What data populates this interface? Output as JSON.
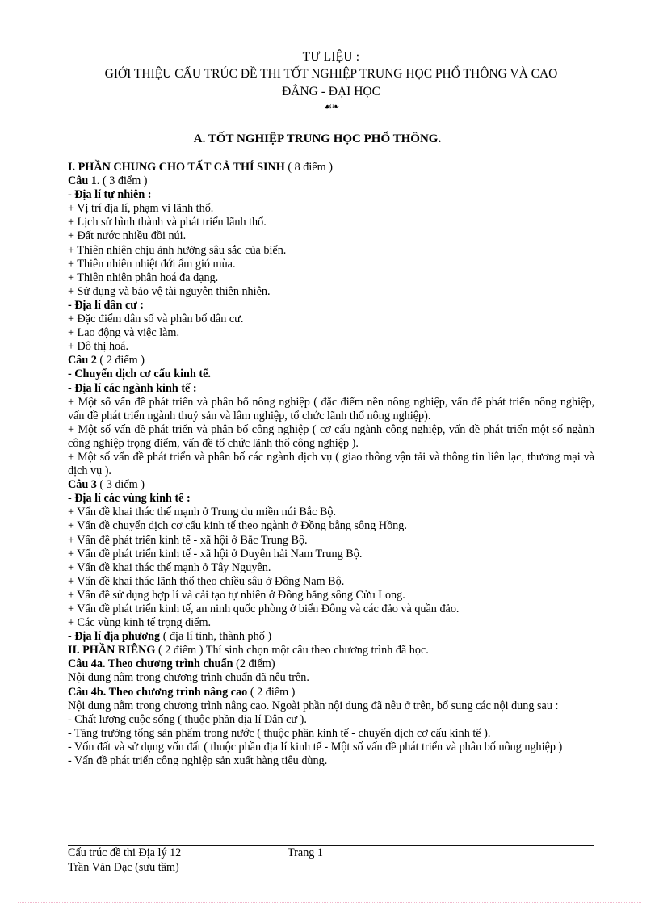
{
  "document": {
    "title_lines": [
      "TƯ LIỆU :",
      "GIỚI THIỆU CẤU TRÚC ĐỀ THI TỐT NGHIỆP TRUNG HỌC PHỔ THÔNG VÀ CAO",
      "ĐẲNG - ĐẠI HỌC"
    ],
    "ornament": "☙❧",
    "section_a_heading": "A. TỐT NGHIỆP TRUNG HỌC PHỔ THÔNG."
  },
  "part_one": {
    "heading_bold": "I. PHẦN CHUNG CHO TẤT CẢ THÍ SINH",
    "heading_normal": "( 8 điểm )",
    "cau1": {
      "label_bold": "Câu 1.",
      "label_normal": "( 3 điểm )",
      "sub1_bold": "- Địa lí tự nhiên :",
      "items1": [
        "+ Vị trí địa lí, phạm vi lãnh thổ.",
        "+ Lịch sử hình thành và phát triển lãnh thổ.",
        "+ Đất nước nhiều  đồi núi.",
        "+ Thiên nhiên  chịu  ảnh hưởng sâu sắc của biển.",
        "+ Thiên nhiên  nhiệt đới ẩm gió mùa.",
        "+ Thiên nhiên  phân hoá đa dạng.",
        "+ Sử dụng và bảo vệ tài nguyên  thiên nhiên."
      ],
      "sub2_bold": "- Địa lí dân cư :",
      "items2": [
        "+ Đặc điểm dân số và phân bố dân cư.",
        "+ Lao động và việc làm.",
        "+ Đô thị hoá."
      ]
    },
    "cau2": {
      "label_bold": "Câu 2",
      "label_normal": "( 2 điểm )",
      "sub1_bold": "- Chuyển dịch cơ cấu kinh tế.",
      "sub2_bold": "- Địa lí các ngành kinh tế :",
      "paragraphs": [
        "+ Một số vấn đề phát triển và phân bố nông nghiệp  ( đặc điểm nền nông nghiệp,  vấn đề phát triển nông nghiệp,  vấn đề phát triển ngành  thuỷ sản và lâm nghiệp, tổ chức lãnh thổ nông nghiệp).",
        "+ Một số vấn đề phát triển và phân bố công nghiệp  ( cơ cấu ngành  công nghiệp,  vấn đề phát triển một số ngành  công nghiệp  trọng điểm, vấn đề tổ chức lãnh thổ công nghiệp  ).",
        "+ Một số vấn đề phát triển và phân bố các ngành  dịch vụ ( giao thông vận tải và thông tin liên lạc, thương mại và dịch vụ )."
      ]
    },
    "cau3": {
      "label_bold": "Câu 3",
      "label_normal": "( 3 điểm )",
      "sub1_bold": "- Địa lí các vùng kinh tế :",
      "items": [
        "+ Vấn đề khai thác thế mạnh  ở Trung  du miền  núi Bắc Bộ.",
        "+ Vấn đề chuyển  dịch cơ cấu kinh tế theo ngành  ở Đồng bằng sông Hồng.",
        "+ Vấn đề phát triển  kinh tế - xã hội ở Bắc Trung  Bộ.",
        "+ Vấn đề phát triển  kinh tế - xã hội ở Duyên  hải Nam Trung  Bộ.",
        "+ Vấn đề khai thác thế mạnh  ở Tây Nguyên.",
        "+ Vấn đề khai thác lãnh thổ theo chiều  sâu ở Đông  Nam Bộ.",
        "+ Vấn đề sử dụng hợp lí  và cải tạo tự nhiên  ở Đồng bằng sông Cửu Long.",
        "+ Vấn đề phát triển  kinh tế, an ninh  quốc phòng ở biển Đông và các đảo và quần đảo.",
        "+ Các vùng  kinh tế trọng điểm."
      ],
      "sub2_bold": "- Địa lí địa phương",
      "sub2_normal": "( địa lí tỉnh,  thành phố )"
    }
  },
  "part_two": {
    "heading_bold": "II. PHẦN RIÊNG",
    "heading_normal": "( 2 điểm ) Thí sinh  chọn một câu theo chương trình  đã học.",
    "cau4a": {
      "label_bold": "Câu 4a.  Theo chương trình chuẩn",
      "label_normal": "(2 điểm)",
      "text": "Nội dung nằm trong chương trình  chuẩn đã nêu trên."
    },
    "cau4b": {
      "label_bold": "Câu 4b. Theo chương trình nâng cao",
      "label_normal": "( 2 điểm )",
      "intro": "Nội dung nằm trong chương trình  nâng cao. Ngoài phần nội dung  đã nêu ở trên, bổ sung  các nội dung sau :",
      "items": [
        "- Chất lượng cuộc sống  ( thuộc  phần địa lí Dân cư ).",
        "- Tăng trưởng tổng sản phẩm trong nước ( thuộc  phần kinh tế - chuyển  dịch  cơ cấu kinh tế ).",
        "- Vốn đất và sử dụng vốn đất ( thuộc  phần địa lí kinh tế - Một số vấn đề phát triển  và phân bố nông nghiệp  )",
        "- Vấn đề phát triển  công nghiệp  sản xuất hàng tiêu  dùng."
      ]
    }
  },
  "footer": {
    "left": "Cấu trúc đề thi Địa lý 12",
    "center": "Trang  1",
    "sub": "Trần Văn Dạc (sưu tầm)"
  }
}
